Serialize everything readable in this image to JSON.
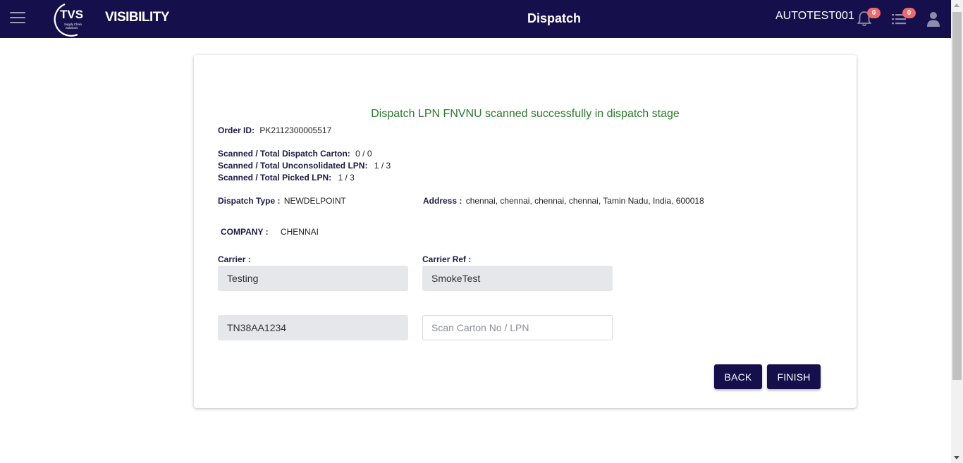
{
  "header": {
    "brand": "VISIBILITY",
    "logo_text": "TVS",
    "logo_subtext": "Supply Chain Solutions",
    "page_title": "Dispatch",
    "username": "AUTOTEST001",
    "notifications_count": "0",
    "tasks_count": "0"
  },
  "card": {
    "success_message": "Dispatch LPN FNVNU scanned successfully in dispatch stage",
    "order_id": {
      "label": "Order ID:",
      "value": "PK2112300005517"
    },
    "dispatch_carton": {
      "label": "Scanned / Total Dispatch Carton:",
      "value": "0 / 0"
    },
    "unconsolidated_lpn": {
      "label": "Scanned / Total Unconsolidated LPN:",
      "value": "1 / 3"
    },
    "picked_lpn": {
      "label": "Scanned / Total Picked LPN:",
      "value": "1 / 3"
    },
    "dispatch_type": {
      "label": "Dispatch Type :",
      "value": "NEWDELPOINT"
    },
    "address": {
      "label": "Address :",
      "value": "chennai, chennai, chennai, chennai, Tamin Nadu, India, 600018"
    },
    "company": {
      "label": "COMPANY :",
      "value": "CHENNAI"
    },
    "carrier": {
      "label": "Carrier :",
      "value": "Testing"
    },
    "carrier_ref": {
      "label": "Carrier Ref :",
      "value": "SmokeTest"
    },
    "vehicle_no": {
      "value": "TN38AA1234"
    },
    "scan_input": {
      "placeholder": "Scan Carton No / LPN",
      "value": ""
    },
    "buttons": {
      "back": "BACK",
      "finish": "FINISH"
    }
  },
  "colors": {
    "header_bg": "#150f4b",
    "success_text": "#2a7a2a",
    "badge": "#ef6a6a",
    "button_bg": "#150f4b"
  }
}
